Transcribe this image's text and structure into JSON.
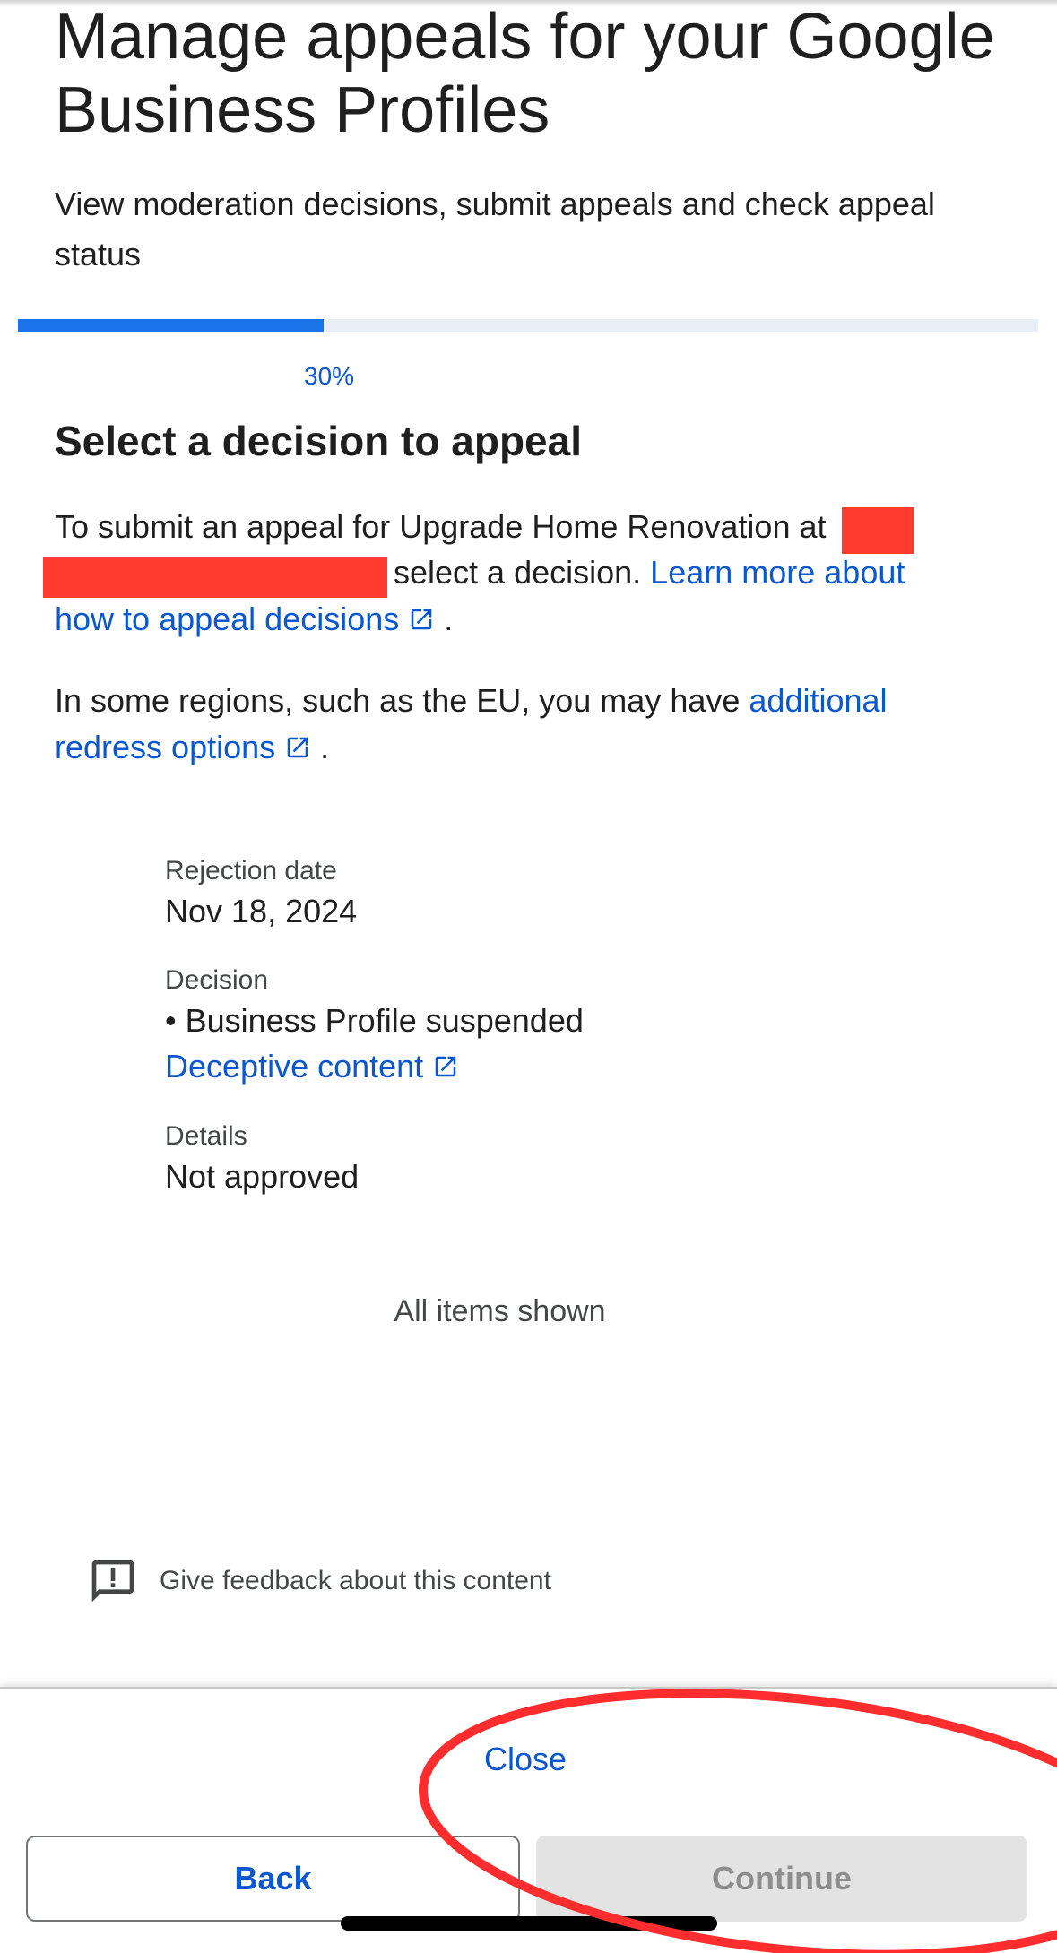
{
  "header": {
    "title": "Manage appeals for your Google Business Profiles",
    "subtitle": "View moderation decisions, submit appeals and check appeal status"
  },
  "progress": {
    "percent": 30,
    "label": "30%"
  },
  "section": {
    "title": "Select a decision to appeal",
    "para1_prefix": "To submit an appeal for Upgrade Home Renovation at",
    "para1_middle": "select a decision.",
    "para1_link_start": "Learn more about",
    "para1_link_end": "how to appeal decisions",
    "para1_suffix": ".",
    "para2_prefix": "In some regions, such as the EU, you may have",
    "para2_link_start": "additional",
    "para2_link_end": "redress options",
    "para2_suffix": "."
  },
  "decision_card": {
    "rejection_date_label": "Rejection date",
    "rejection_date_value": "Nov 18, 2024",
    "decision_label": "Decision",
    "decision_value": "• Business Profile suspended",
    "decision_link": "Deceptive content",
    "details_label": "Details",
    "details_value": "Not approved"
  },
  "list_footer": "All items shown",
  "feedback": {
    "label": "Give feedback about this content",
    "icon": "feedback-icon"
  },
  "footer": {
    "close_label": "Close",
    "back_label": "Back",
    "continue_label": "Continue"
  },
  "colors": {
    "accent": "#1a73e8",
    "link": "#0b57d0",
    "redaction": "#ff3b30",
    "annotation": "#ff2d2d"
  }
}
